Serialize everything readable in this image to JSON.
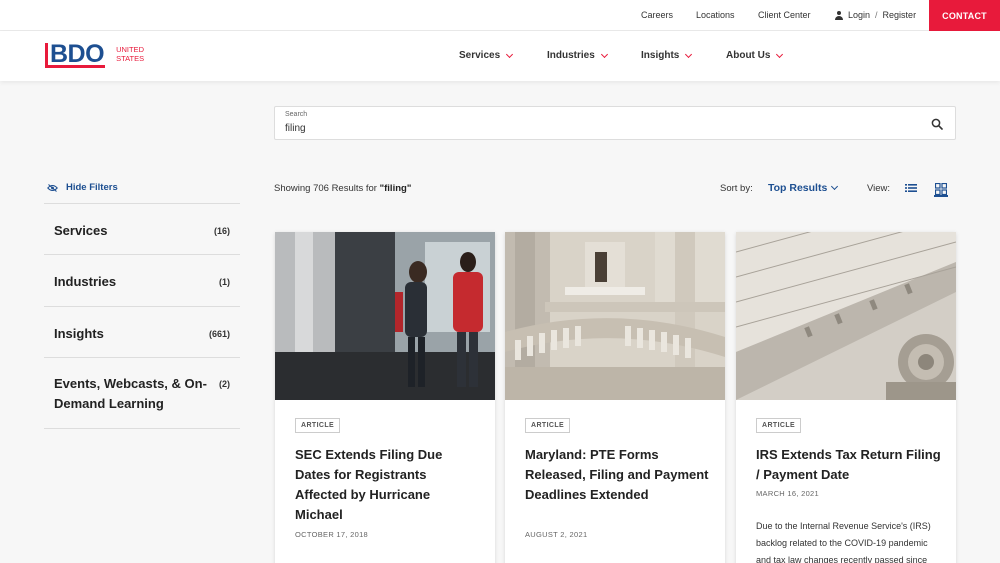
{
  "utility": {
    "careers": "Careers",
    "locations": "Locations",
    "client_center": "Client Center",
    "login": "Login",
    "separator": "/",
    "register": "Register",
    "contact": "CONTACT"
  },
  "header": {
    "logo_text": "BDO",
    "logo_sub_line1": "UNITED",
    "logo_sub_line2": "STATES",
    "nav": [
      "Services",
      "Industries",
      "Insights",
      "About Us"
    ]
  },
  "search": {
    "label": "Search",
    "value": "filing"
  },
  "filters": {
    "hide_label": "Hide Filters",
    "items": [
      {
        "label": "Services",
        "count": "(16)"
      },
      {
        "label": "Industries",
        "count": "(1)"
      },
      {
        "label": "Insights",
        "count": "(661)"
      },
      {
        "label": "Events, Webcasts, & On-Demand Learning",
        "count": "(2)"
      }
    ]
  },
  "results": {
    "showing_prefix": "Showing 706 Results for ",
    "query_quoted": "\"filing\"",
    "sort_label": "Sort by:",
    "sort_value": "Top Results",
    "view_label": "View:"
  },
  "cards": [
    {
      "badge": "ARTICLE",
      "title": "SEC Extends Filing Due Dates for Registrants Affected by Hurricane Michael",
      "date": "OCTOBER 17, 2018",
      "image": "office-meeting-photo"
    },
    {
      "badge": "ARTICLE",
      "title": "Maryland: PTE Forms Released, Filing and Payment Deadlines Extended",
      "date": "AUGUST 2, 2021",
      "image": "capitol-interior-photo"
    },
    {
      "badge": "ARTICLE",
      "title": "IRS Extends Tax Return Filing / Payment Date",
      "date": "MARCH 16, 2021",
      "excerpt": "Due to the Internal Revenue Service's (IRS) backlog related to the COVID-19 pandemic and tax law changes recently passed since the start",
      "image": "united-states-building-photo"
    }
  ],
  "colors": {
    "brand_red": "#e81a3b",
    "brand_blue": "#1d4f91"
  }
}
